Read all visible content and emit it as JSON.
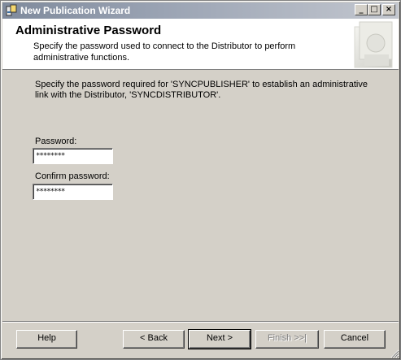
{
  "window": {
    "title": "New Publication Wizard",
    "controls": {
      "minimize": "_",
      "maximize": "□",
      "close": "×"
    }
  },
  "header": {
    "title": "Administrative Password",
    "description": "Specify the password used to connect to the Distributor to perform administrative functions."
  },
  "main": {
    "instruction": "Specify the password required for 'SYNCPUBLISHER' to establish an administrative link with the Distributor, 'SYNCDISTRIBUTOR'.",
    "password": {
      "label": "Password:",
      "value": "********"
    },
    "confirm_password": {
      "label": "Confirm password:",
      "value": "********"
    }
  },
  "buttons": {
    "help": "Help",
    "back": "< Back",
    "next": "Next >",
    "finish": "Finish >>|",
    "cancel": "Cancel"
  },
  "colors": {
    "dialog_face": "#d4d0c8",
    "title_bar": "#8a94a6",
    "header_bg": "#ffffff"
  },
  "icons": [
    "app-icon",
    "minimize-icon",
    "maximize-icon",
    "close-icon",
    "header-graphic",
    "size-grip-icon"
  ]
}
